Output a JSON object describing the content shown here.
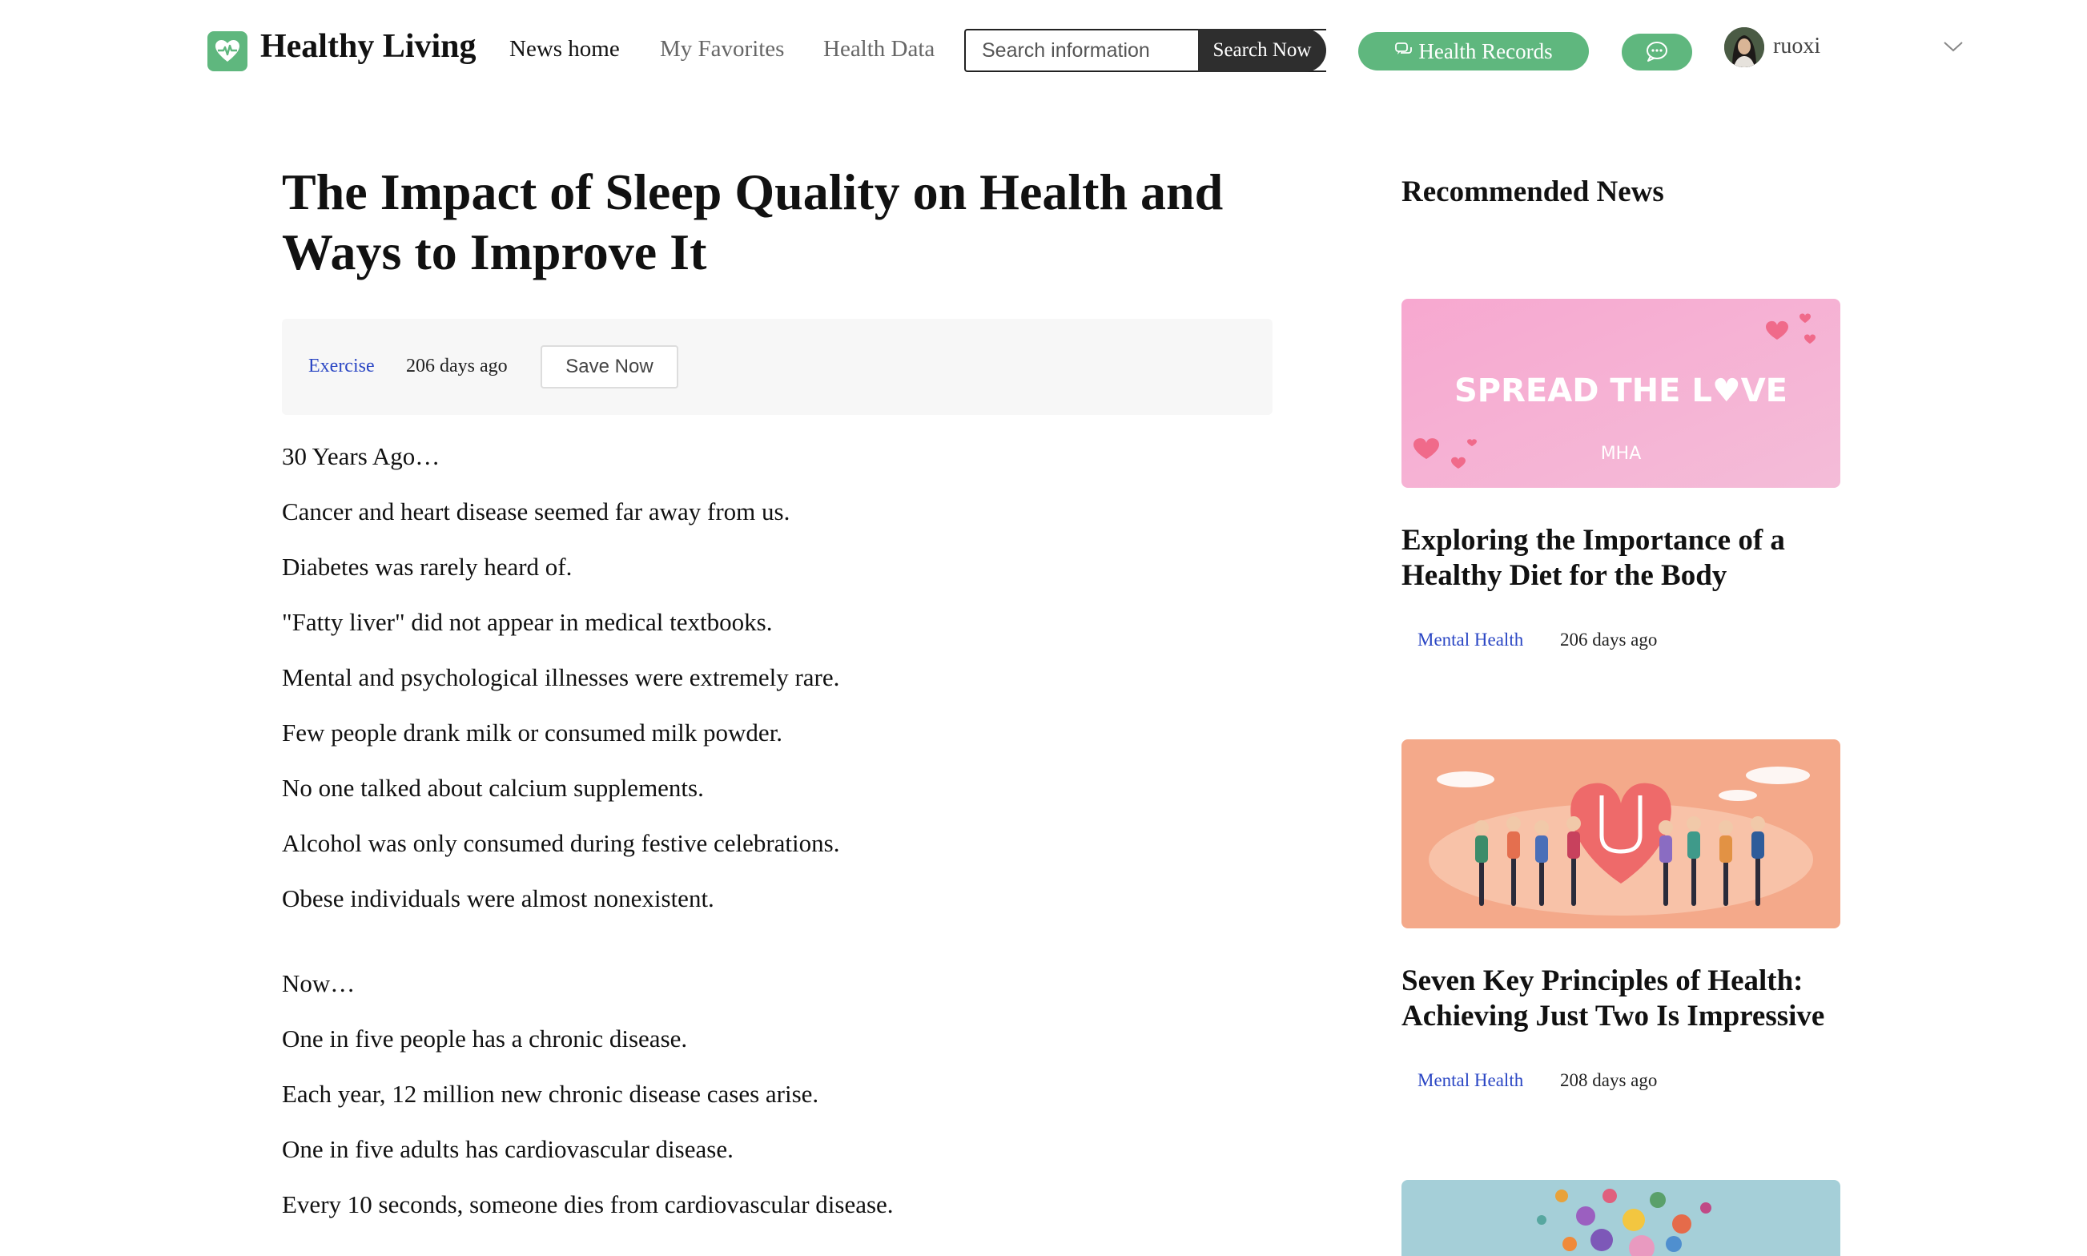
{
  "header": {
    "brand": "Healthy Living",
    "nav": {
      "home": "News home",
      "favorites": "My Favorites",
      "health_data": "Health Data"
    },
    "search": {
      "placeholder": "Search information",
      "button": "Search Now"
    },
    "records_button": "Health Records",
    "username": "ruoxi",
    "accent_color": "#5fb77e"
  },
  "article": {
    "title": "The Impact of Sleep Quality on Health and Ways to Improve It",
    "category": "Exercise",
    "date": "206 days ago",
    "save_button": "Save Now",
    "paragraphs": [
      "30 Years Ago…",
      "Cancer and heart disease seemed far away from us.",
      "Diabetes was rarely heard of.",
      "\"Fatty liver\" did not appear in medical textbooks.",
      "Mental and psychological illnesses were extremely rare.",
      "Few people drank milk or consumed milk powder.",
      "No one talked about calcium supplements.",
      "Alcohol was only consumed during festive celebrations.",
      "Obese individuals were almost nonexistent.",
      "Now…",
      "One in five people has a chronic disease.",
      "Each year, 12 million new chronic disease cases arise.",
      "One in five adults has cardiovascular disease.",
      "Every 10 seconds, someone dies from cardiovascular disease."
    ]
  },
  "sidebar": {
    "title": "Recommended News",
    "cards": [
      {
        "image_text": "SPREAD THE L♥VE",
        "image_logo": "MHA",
        "title": "Exploring the Importance of a Healthy Diet for the Body",
        "tag": "Mental Health",
        "date": "206 days ago"
      },
      {
        "title": "Seven Key Principles of Health: Achieving Just Two Is Impressive",
        "tag": "Mental Health",
        "date": "208 days ago"
      }
    ]
  }
}
